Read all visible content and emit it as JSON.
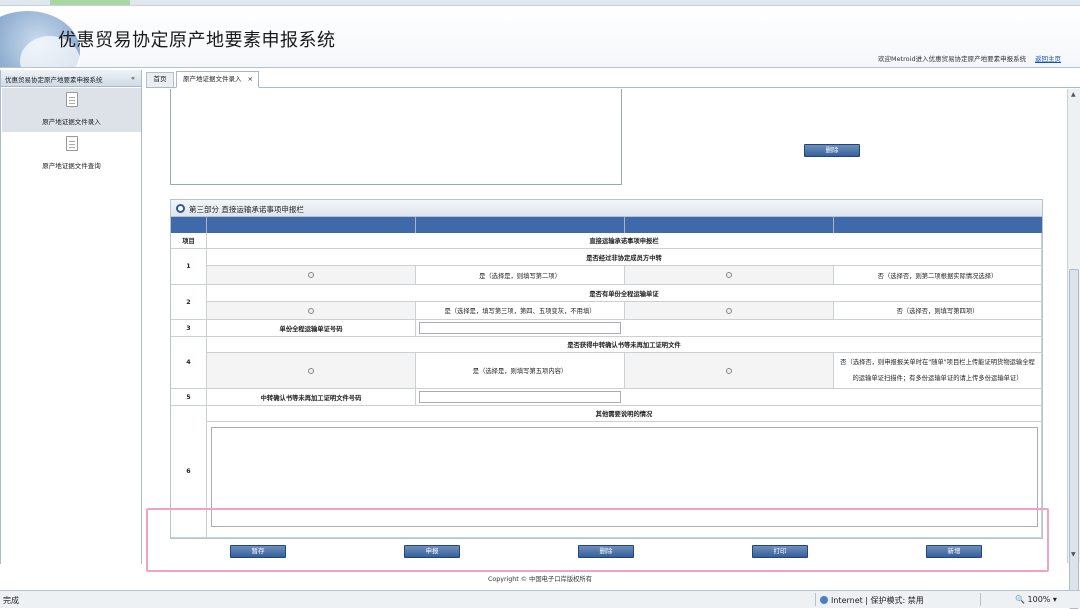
{
  "window": {
    "title": "优惠贸易协定原产地要素申报系统"
  },
  "header": {
    "welcome": "欢迎Metroid进入优惠贸易协定原产地要素申报系统",
    "home_link": "返回主页"
  },
  "sidebar": {
    "title": "优惠贸易协定原产地要素申报系统",
    "collapse": "«",
    "items": [
      {
        "label": "原产地证据文件录入",
        "icon": "document-icon"
      },
      {
        "label": "原产地证据文件查询",
        "icon": "document-icon"
      }
    ]
  },
  "tabs": [
    {
      "label": "首页"
    },
    {
      "label": "原产地证据文件录入",
      "close": "×"
    }
  ],
  "upper": {
    "delete_label": "删除"
  },
  "section3": {
    "title": "第三部分 直接运输承诺事项申报栏",
    "col_item": "项目",
    "col_main": "直接运输承诺事项申报栏",
    "rows": {
      "r1": {
        "num": "1",
        "question": "是否经过非协定成员方中转",
        "yes": "是（选择是，则填写第二项）",
        "no": "否（选择否，则第二项根据实际情况选择）"
      },
      "r2": {
        "num": "2",
        "question": "是否有单份全程运输单证",
        "yes": "是（选择是，填写第三项，第四、五项变灰，不用填）",
        "no": "否（选择否，则填写第四项）"
      },
      "r3": {
        "num": "3",
        "label": "单份全程运输单证号码"
      },
      "r4": {
        "num": "4",
        "question": "是否获得中转确认书等未再加工证明文件",
        "yes": "是（选择是，则填写第五项内容）",
        "no_line1": "否（选择否，则申报报关单时在\"随单\"项目栏上传能证明货物运输全程",
        "no_line2": "的运输单证扫描件；有多份运输单证的请上传多份运输单证）"
      },
      "r5": {
        "num": "5",
        "label": "中转确认书等未再加工证明文件号码"
      },
      "r6": {
        "num": "6",
        "label": "其他需要说明的情况"
      }
    }
  },
  "actions": {
    "save": "暂存",
    "submit": "申报",
    "delete": "删除",
    "print": "打印",
    "new": "新增"
  },
  "footer": {
    "copyright": "Copyright © 中国电子口岸版权所有"
  },
  "statusbar": {
    "status": "完成",
    "zone": "Internet | 保护模式: 禁用",
    "zoom": "100%"
  },
  "colors": {
    "accent": "#3f69a8",
    "button": "#37609a",
    "highlight": "#f2a3c3"
  }
}
